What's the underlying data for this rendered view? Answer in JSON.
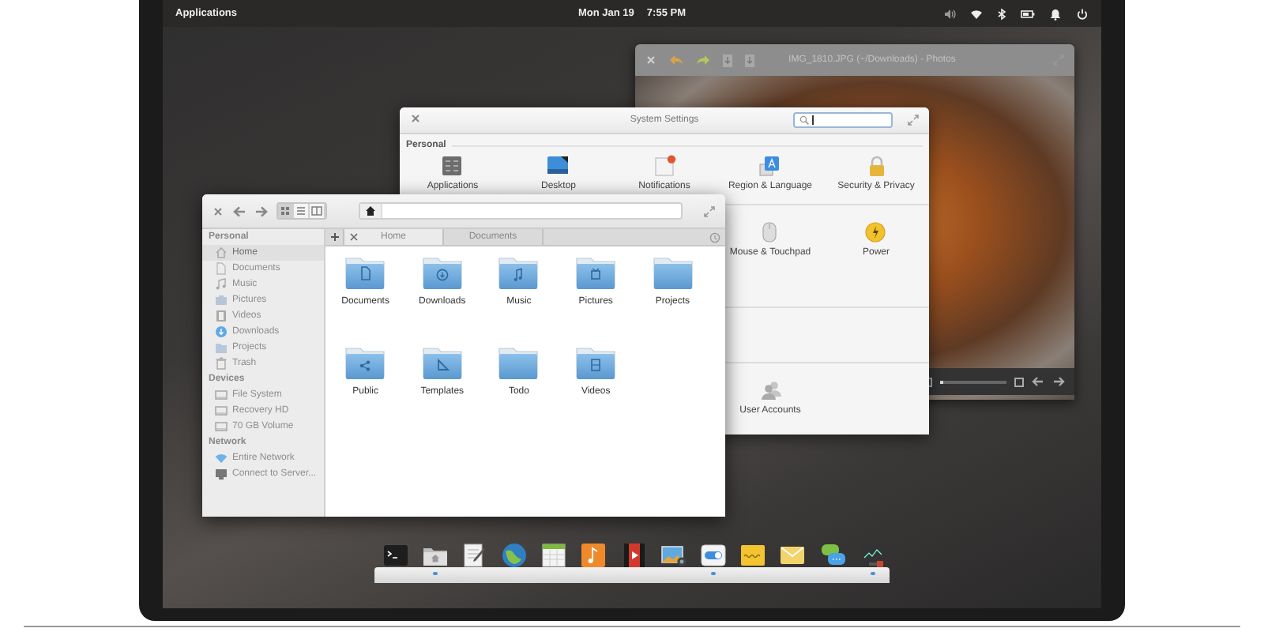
{
  "top_panel": {
    "applications": "Applications",
    "date": "Mon Jan 19",
    "time": "7:55 PM"
  },
  "photos_window": {
    "title": "IMG_1810.JPG (~/Downloads) - Photos",
    "zoom_slider": {
      "level": 0
    }
  },
  "settings_window": {
    "title": "System Settings",
    "sections": [
      {
        "title": "Personal",
        "items": [
          {
            "kind": "applications",
            "label": "Applications"
          },
          {
            "kind": "desktop",
            "label": "Desktop"
          },
          {
            "kind": "notifications",
            "label": "Notifications"
          },
          {
            "kind": "region",
            "label": "Region & Language"
          },
          {
            "kind": "security",
            "label": "Security & Privacy"
          }
        ]
      },
      {
        "items": [
          {
            "kind": "mouse",
            "label": "Mouse & Touchpad"
          },
          {
            "kind": "power",
            "label": "Power"
          }
        ]
      },
      {
        "items": [
          {
            "kind": "accounts",
            "label": "User Accounts"
          }
        ]
      }
    ]
  },
  "files_window": {
    "view_modes": [
      {
        "kind": "icons",
        "selected": true
      },
      {
        "kind": "list",
        "selected": false
      },
      {
        "kind": "columns",
        "selected": false
      }
    ],
    "sidebar": [
      {
        "title": "Personal",
        "items": [
          {
            "kind": "home",
            "label": "Home",
            "selected": true
          },
          {
            "kind": "document",
            "label": "Documents",
            "selected": false
          },
          {
            "kind": "music",
            "label": "Music",
            "selected": false
          },
          {
            "kind": "pictures",
            "label": "Pictures",
            "selected": false
          },
          {
            "kind": "videos",
            "label": "Videos",
            "selected": false
          },
          {
            "kind": "downloads",
            "label": "Downloads",
            "selected": false
          },
          {
            "kind": "folder",
            "label": "Projects",
            "selected": false
          },
          {
            "kind": "trash",
            "label": "Trash",
            "selected": false
          }
        ]
      },
      {
        "title": "Devices",
        "items": [
          {
            "kind": "drive",
            "label": "File System",
            "selected": false
          },
          {
            "kind": "drive",
            "label": "Recovery HD",
            "selected": false
          },
          {
            "kind": "drive",
            "label": "70 GB Volume",
            "selected": false
          }
        ]
      },
      {
        "title": "Network",
        "items": [
          {
            "kind": "network",
            "label": "Entire Network",
            "selected": false
          },
          {
            "kind": "server",
            "label": "Connect to Server...",
            "selected": false
          }
        ]
      }
    ],
    "tabs": [
      {
        "label": "Home",
        "selected": true
      },
      {
        "label": "Documents",
        "selected": false
      }
    ],
    "folders": [
      {
        "kind": "documents",
        "label": "Documents"
      },
      {
        "kind": "downloads",
        "label": "Downloads"
      },
      {
        "kind": "music",
        "label": "Music"
      },
      {
        "kind": "pictures",
        "label": "Pictures"
      },
      {
        "kind": "plain",
        "label": "Projects"
      },
      {
        "kind": "public",
        "label": "Public"
      },
      {
        "kind": "templates",
        "label": "Templates"
      },
      {
        "kind": "plain",
        "label": "Todo"
      },
      {
        "kind": "videos",
        "label": "Videos"
      }
    ]
  },
  "dock": {
    "apps": [
      {
        "kind": "terminal",
        "running": false
      },
      {
        "kind": "files",
        "running": true
      },
      {
        "kind": "editor",
        "running": false
      },
      {
        "kind": "browser",
        "running": false
      },
      {
        "kind": "calendar",
        "running": false
      },
      {
        "kind": "music",
        "running": false
      },
      {
        "kind": "video",
        "running": false
      },
      {
        "kind": "photos",
        "running": false
      },
      {
        "kind": "settings",
        "running": true
      },
      {
        "kind": "notes",
        "running": false
      },
      {
        "kind": "mail",
        "running": false
      },
      {
        "kind": "chat",
        "running": false
      },
      {
        "kind": "monitor",
        "running": true
      }
    ]
  }
}
